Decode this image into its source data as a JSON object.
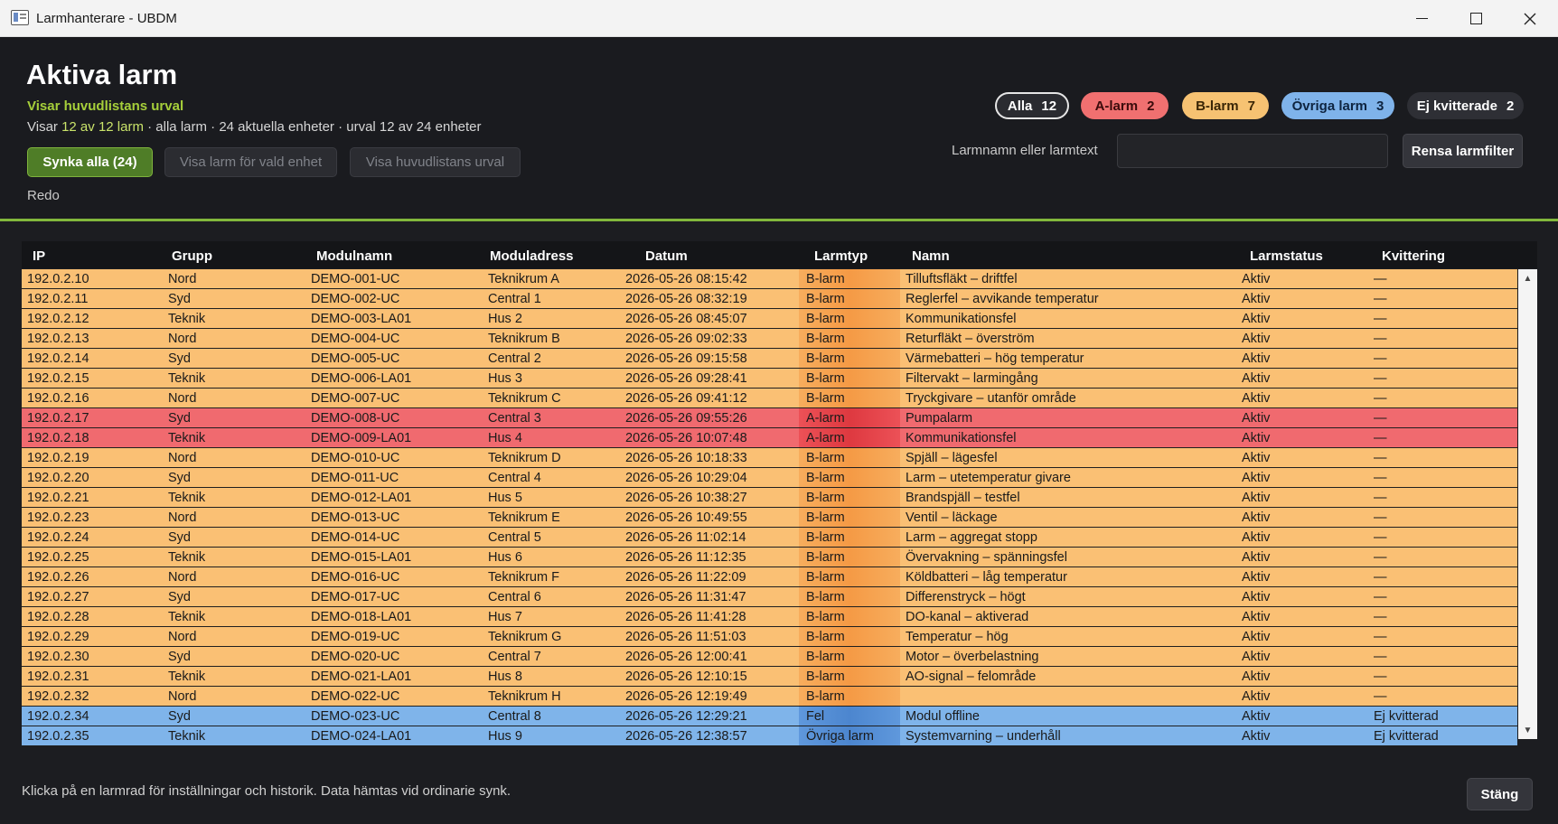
{
  "window": {
    "title": "Larmhanterare - UBDM"
  },
  "header": {
    "title": "Aktiva larm",
    "subtitle": "Visar huvudlistans urval",
    "summary_prefix": "Visar",
    "summary_highlight": "12 av 12 larm",
    "summary_suffix": "· alla larm · 24 aktuella enheter · urval 12 av 24 enheter",
    "sync_button": "Synka alla (24)",
    "unit_button": "Visa larm för vald enhet",
    "main_list_button": "Visa huvudlistans urval",
    "status": "Redo"
  },
  "filters": {
    "chips": [
      {
        "label": "Alla",
        "count": "12"
      },
      {
        "label": "A-larm",
        "count": "2"
      },
      {
        "label": "B-larm",
        "count": "7"
      },
      {
        "label": "Övriga larm",
        "count": "3"
      },
      {
        "label": "Ej kvitterade",
        "count": "2"
      }
    ],
    "search_label": "Larmnamn eller larmtext",
    "search_value": "",
    "clear_button": "Rensa larmfilter"
  },
  "colors": {
    "a_alarm": "#f06a6f",
    "b_alarm": "#fac074",
    "other_alarm": "#7fb4ea",
    "accent": "#82b83c"
  },
  "table": {
    "columns": [
      "IP",
      "Grupp",
      "Modulnamn",
      "Moduladress",
      "Datum",
      "Larmtyp",
      "Namn",
      "Larmstatus",
      "Kvittering"
    ],
    "rows": [
      {
        "ip": "192.0.2.10",
        "group": "Nord",
        "module": "DEMO-001-UC",
        "address": "Teknikrum A",
        "date": "2026-05-26 08:15:42",
        "type": "B-larm",
        "name": "Tilluftsfläkt – driftfel",
        "status": "Aktiv",
        "ack": "—",
        "cls": "b"
      },
      {
        "ip": "192.0.2.11",
        "group": "Syd",
        "module": "DEMO-002-UC",
        "address": "Central 1",
        "date": "2026-05-26 08:32:19",
        "type": "B-larm",
        "name": "Reglerfel – avvikande temperatur",
        "status": "Aktiv",
        "ack": "—",
        "cls": "b"
      },
      {
        "ip": "192.0.2.12",
        "group": "Teknik",
        "module": "DEMO-003-LA01",
        "address": "Hus 2",
        "date": "2026-05-26 08:45:07",
        "type": "B-larm",
        "name": "Kommunikationsfel",
        "status": "Aktiv",
        "ack": "—",
        "cls": "b"
      },
      {
        "ip": "192.0.2.13",
        "group": "Nord",
        "module": "DEMO-004-UC",
        "address": "Teknikrum B",
        "date": "2026-05-26 09:02:33",
        "type": "B-larm",
        "name": "Returfläkt – överström",
        "status": "Aktiv",
        "ack": "—",
        "cls": "b"
      },
      {
        "ip": "192.0.2.14",
        "group": "Syd",
        "module": "DEMO-005-UC",
        "address": "Central 2",
        "date": "2026-05-26 09:15:58",
        "type": "B-larm",
        "name": "Värmebatteri – hög temperatur",
        "status": "Aktiv",
        "ack": "—",
        "cls": "b"
      },
      {
        "ip": "192.0.2.15",
        "group": "Teknik",
        "module": "DEMO-006-LA01",
        "address": "Hus 3",
        "date": "2026-05-26 09:28:41",
        "type": "B-larm",
        "name": "Filtervakt – larmingång",
        "status": "Aktiv",
        "ack": "—",
        "cls": "b"
      },
      {
        "ip": "192.0.2.16",
        "group": "Nord",
        "module": "DEMO-007-UC",
        "address": "Teknikrum C",
        "date": "2026-05-26 09:41:12",
        "type": "B-larm",
        "name": "Tryckgivare – utanför område",
        "status": "Aktiv",
        "ack": "—",
        "cls": "b"
      },
      {
        "ip": "192.0.2.17",
        "group": "Syd",
        "module": "DEMO-008-UC",
        "address": "Central 3",
        "date": "2026-05-26 09:55:26",
        "type": "A-larm",
        "name": "Pumpalarm",
        "status": "Aktiv",
        "ack": "—",
        "cls": "a"
      },
      {
        "ip": "192.0.2.18",
        "group": "Teknik",
        "module": "DEMO-009-LA01",
        "address": "Hus 4",
        "date": "2026-05-26 10:07:48",
        "type": "A-larm",
        "name": "Kommunikationsfel",
        "status": "Aktiv",
        "ack": "—",
        "cls": "a"
      },
      {
        "ip": "192.0.2.19",
        "group": "Nord",
        "module": "DEMO-010-UC",
        "address": "Teknikrum D",
        "date": "2026-05-26 10:18:33",
        "type": "B-larm",
        "name": "Spjäll – lägesfel",
        "status": "Aktiv",
        "ack": "—",
        "cls": "b"
      },
      {
        "ip": "192.0.2.20",
        "group": "Syd",
        "module": "DEMO-011-UC",
        "address": "Central 4",
        "date": "2026-05-26 10:29:04",
        "type": "B-larm",
        "name": "Larm – utetemperatur givare",
        "status": "Aktiv",
        "ack": "—",
        "cls": "b"
      },
      {
        "ip": "192.0.2.21",
        "group": "Teknik",
        "module": "DEMO-012-LA01",
        "address": "Hus 5",
        "date": "2026-05-26 10:38:27",
        "type": "B-larm",
        "name": "Brandspjäll – testfel",
        "status": "Aktiv",
        "ack": "—",
        "cls": "b"
      },
      {
        "ip": "192.0.2.23",
        "group": "Nord",
        "module": "DEMO-013-UC",
        "address": "Teknikrum E",
        "date": "2026-05-26 10:49:55",
        "type": "B-larm",
        "name": "Ventil – läckage",
        "status": "Aktiv",
        "ack": "—",
        "cls": "b"
      },
      {
        "ip": "192.0.2.24",
        "group": "Syd",
        "module": "DEMO-014-UC",
        "address": "Central 5",
        "date": "2026-05-26 11:02:14",
        "type": "B-larm",
        "name": "Larm – aggregat stopp",
        "status": "Aktiv",
        "ack": "—",
        "cls": "b"
      },
      {
        "ip": "192.0.2.25",
        "group": "Teknik",
        "module": "DEMO-015-LA01",
        "address": "Hus 6",
        "date": "2026-05-26 11:12:35",
        "type": "B-larm",
        "name": "Övervakning – spänningsfel",
        "status": "Aktiv",
        "ack": "—",
        "cls": "b"
      },
      {
        "ip": "192.0.2.26",
        "group": "Nord",
        "module": "DEMO-016-UC",
        "address": "Teknikrum F",
        "date": "2026-05-26 11:22:09",
        "type": "B-larm",
        "name": "Köldbatteri – låg temperatur",
        "status": "Aktiv",
        "ack": "—",
        "cls": "b"
      },
      {
        "ip": "192.0.2.27",
        "group": "Syd",
        "module": "DEMO-017-UC",
        "address": "Central 6",
        "date": "2026-05-26 11:31:47",
        "type": "B-larm",
        "name": "Differenstryck – högt",
        "status": "Aktiv",
        "ack": "—",
        "cls": "b"
      },
      {
        "ip": "192.0.2.28",
        "group": "Teknik",
        "module": "DEMO-018-LA01",
        "address": "Hus 7",
        "date": "2026-05-26 11:41:28",
        "type": "B-larm",
        "name": "DO-kanal – aktiverad",
        "status": "Aktiv",
        "ack": "—",
        "cls": "b"
      },
      {
        "ip": "192.0.2.29",
        "group": "Nord",
        "module": "DEMO-019-UC",
        "address": "Teknikrum G",
        "date": "2026-05-26 11:51:03",
        "type": "B-larm",
        "name": "Temperatur – hög",
        "status": "Aktiv",
        "ack": "—",
        "cls": "b"
      },
      {
        "ip": "192.0.2.30",
        "group": "Syd",
        "module": "DEMO-020-UC",
        "address": "Central 7",
        "date": "2026-05-26 12:00:41",
        "type": "B-larm",
        "name": "Motor – överbelastning",
        "status": "Aktiv",
        "ack": "—",
        "cls": "b"
      },
      {
        "ip": "192.0.2.31",
        "group": "Teknik",
        "module": "DEMO-021-LA01",
        "address": "Hus 8",
        "date": "2026-05-26 12:10:15",
        "type": "B-larm",
        "name": "AO-signal – felområde",
        "status": "Aktiv",
        "ack": "—",
        "cls": "b"
      },
      {
        "ip": "192.0.2.32",
        "group": "Nord",
        "module": "DEMO-022-UC",
        "address": "Teknikrum H",
        "date": "2026-05-26 12:19:49",
        "type": "B-larm",
        "name": "",
        "status": "Aktiv",
        "ack": "—",
        "cls": "b"
      },
      {
        "ip": "192.0.2.34",
        "group": "Syd",
        "module": "DEMO-023-UC",
        "address": "Central 8",
        "date": "2026-05-26 12:29:21",
        "type": "Fel",
        "name": "Modul offline",
        "status": "Aktiv",
        "ack": "Ej kvitterad",
        "cls": "o"
      },
      {
        "ip": "192.0.2.35",
        "group": "Teknik",
        "module": "DEMO-024-LA01",
        "address": "Hus 9",
        "date": "2026-05-26 12:38:57",
        "type": "Övriga larm",
        "name": "Systemvarning – underhåll",
        "status": "Aktiv",
        "ack": "Ej kvitterad",
        "cls": "o"
      }
    ]
  },
  "footer": {
    "hint": "Klicka på en larmrad för inställningar och historik. Data hämtas vid ordinarie synk.",
    "close_button": "Stäng"
  }
}
